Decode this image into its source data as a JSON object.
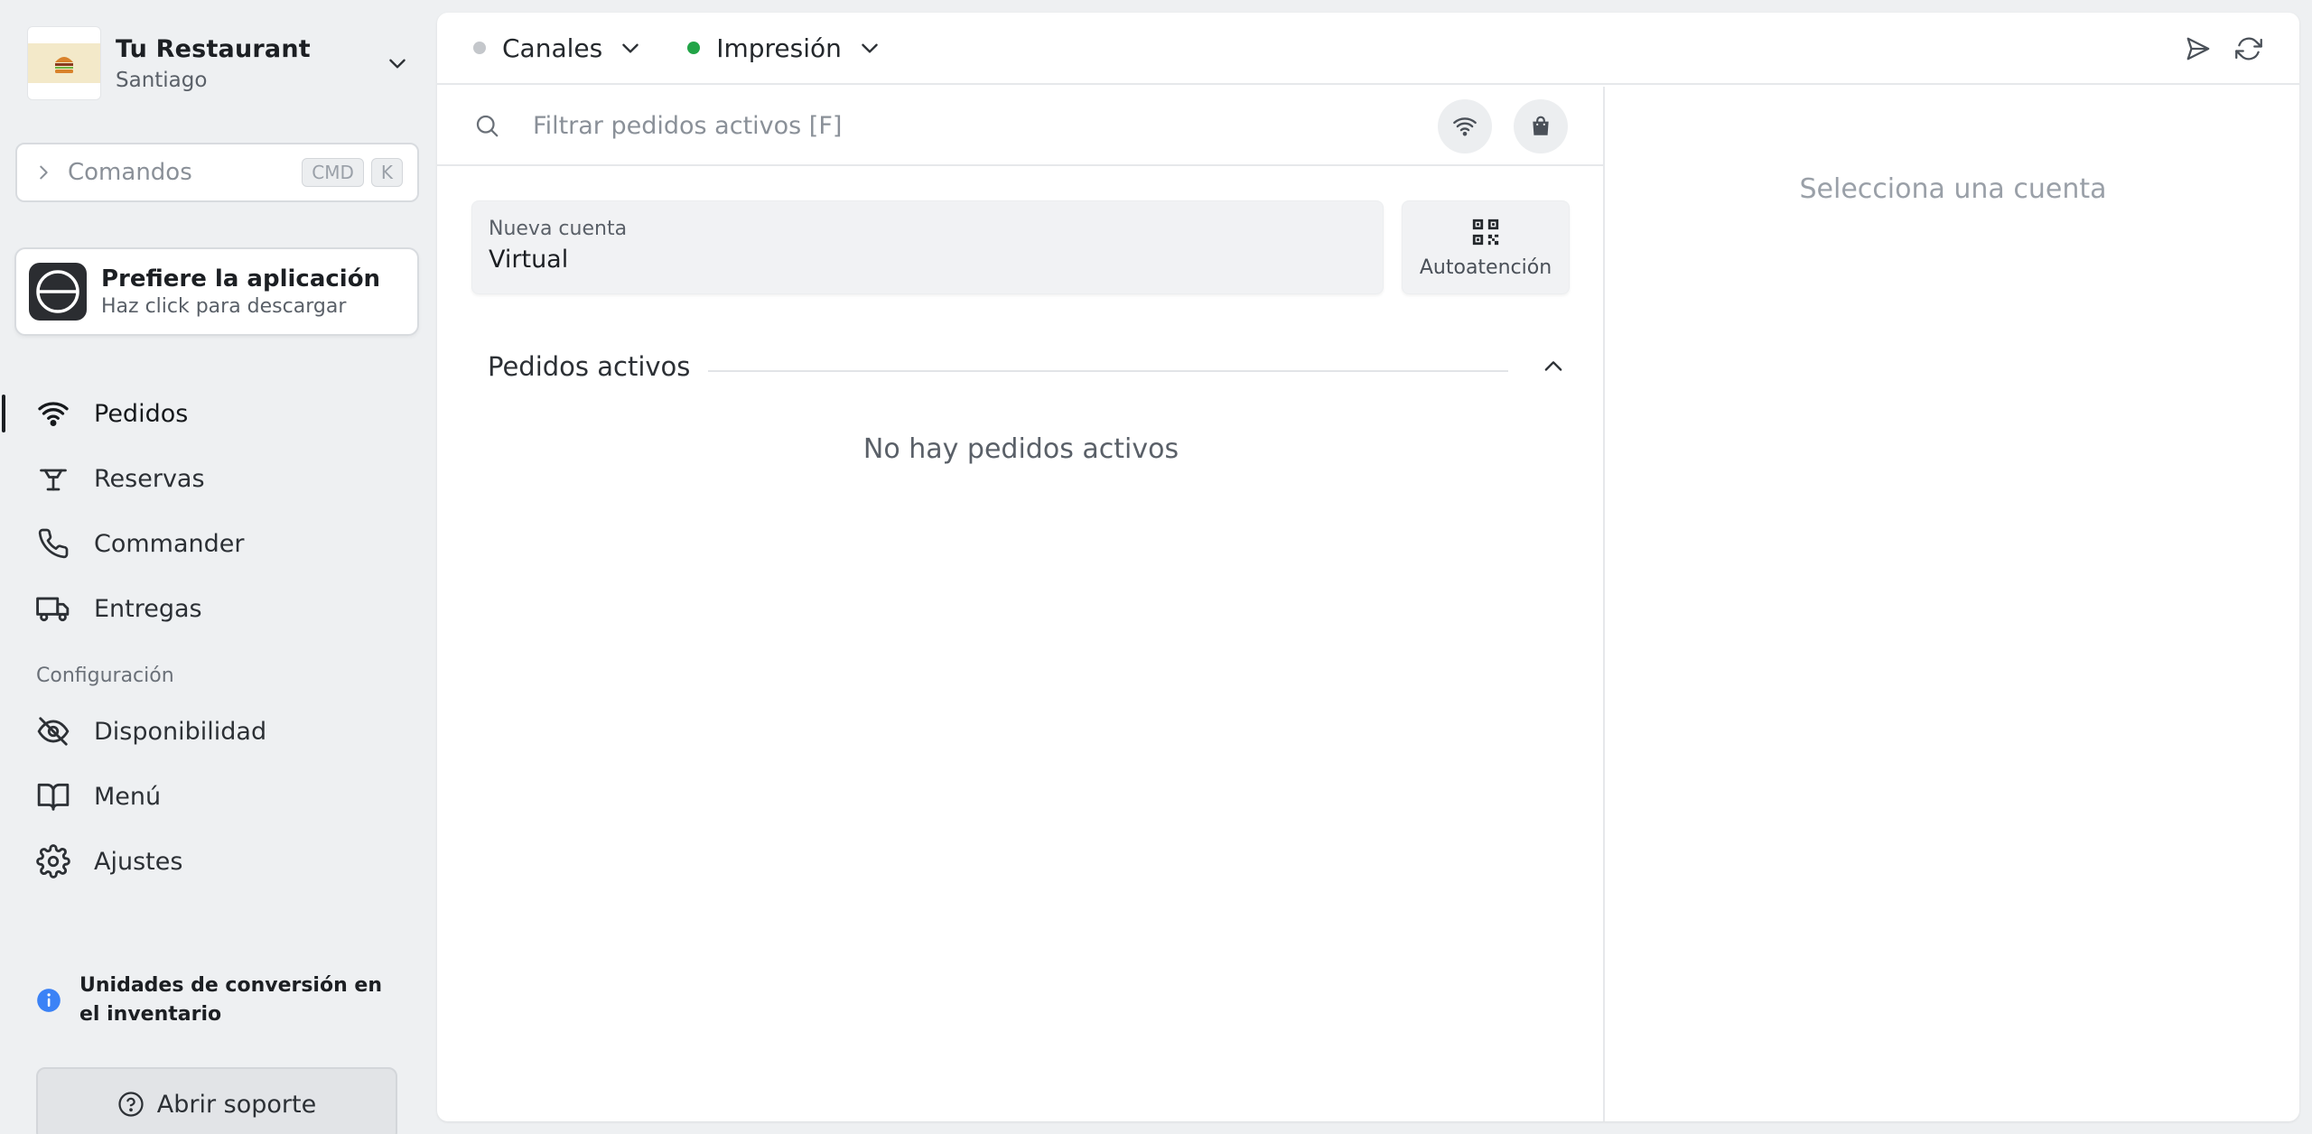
{
  "brand": {
    "name": "Tu Restaurant",
    "city": "Santiago"
  },
  "commands": {
    "label": "Comandos",
    "kbd_mod": "CMD",
    "kbd_key": "K"
  },
  "app_promo": {
    "title": "Prefiere la aplicación",
    "subtitle": "Haz click para descargar"
  },
  "nav": {
    "primary": [
      {
        "label": "Pedidos",
        "icon": "wifi-icon",
        "active": true
      },
      {
        "label": "Reservas",
        "icon": "table-icon"
      },
      {
        "label": "Commander",
        "icon": "phone-icon"
      },
      {
        "label": "Entregas",
        "icon": "truck-icon"
      }
    ],
    "config_label": "Configuración",
    "config": [
      {
        "label": "Disponibilidad",
        "icon": "eye-off-icon"
      },
      {
        "label": "Menú",
        "icon": "book-icon"
      },
      {
        "label": "Ajustes",
        "icon": "gear-icon"
      }
    ]
  },
  "notice": {
    "text": "Unidades de conversión en el inventario"
  },
  "support": {
    "label": "Abrir soporte"
  },
  "topbar": {
    "channels": {
      "label": "Canales",
      "status_color": "#c4c7cb"
    },
    "printing": {
      "label": "Impresión",
      "status_color": "#22a447"
    }
  },
  "search": {
    "placeholder": "Filtrar pedidos activos [F]"
  },
  "new_account": {
    "caption": "Nueva cuenta",
    "value": "Virtual"
  },
  "self_service": {
    "label": "Autoatención"
  },
  "active_orders": {
    "title": "Pedidos activos",
    "empty": "No hay pedidos activos"
  },
  "detail": {
    "placeholder": "Selecciona una cuenta"
  },
  "colors": {
    "accent_dark": "#1c1f23",
    "info_blue": "#3b82f6",
    "status_green": "#22a447"
  }
}
